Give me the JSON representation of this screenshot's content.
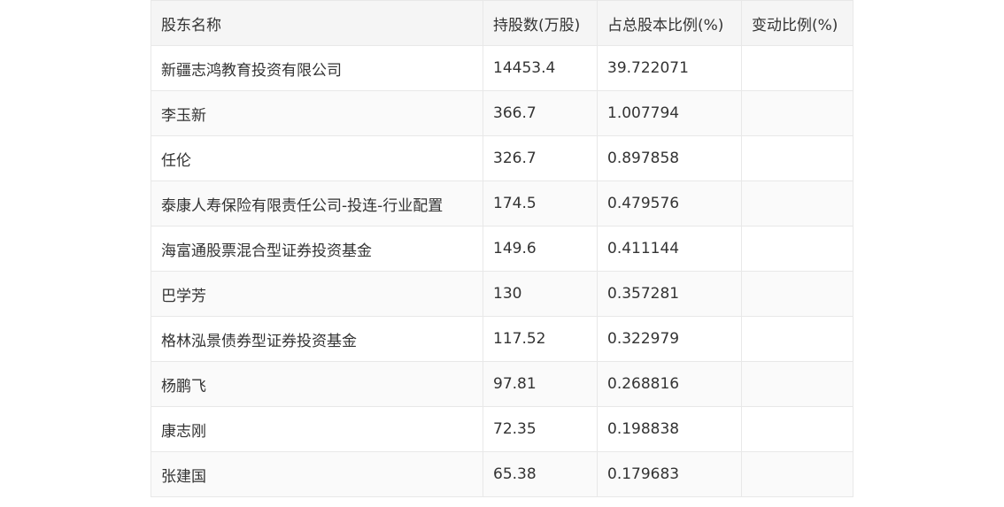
{
  "table": {
    "headers": {
      "name": "股东名称",
      "shares": "持股数(万股)",
      "ratio": "占总股本比例(%)",
      "change": "变动比例(%)"
    },
    "rows": [
      {
        "name": "新疆志鸿教育投资有限公司",
        "shares": "14453.4",
        "ratio": "39.722071",
        "change": ""
      },
      {
        "name": "李玉新",
        "shares": "366.7",
        "ratio": "1.007794",
        "change": ""
      },
      {
        "name": "任伦",
        "shares": "326.7",
        "ratio": "0.897858",
        "change": ""
      },
      {
        "name": "泰康人寿保险有限责任公司-投连-行业配置",
        "shares": "174.5",
        "ratio": "0.479576",
        "change": ""
      },
      {
        "name": "海富通股票混合型证券投资基金",
        "shares": "149.6",
        "ratio": "0.411144",
        "change": ""
      },
      {
        "name": "巴学芳",
        "shares": "130",
        "ratio": "0.357281",
        "change": ""
      },
      {
        "name": "格林泓景债券型证券投资基金",
        "shares": "117.52",
        "ratio": "0.322979",
        "change": ""
      },
      {
        "name": "杨鹏飞",
        "shares": "97.81",
        "ratio": "0.268816",
        "change": ""
      },
      {
        "name": "康志刚",
        "shares": "72.35",
        "ratio": "0.198838",
        "change": ""
      },
      {
        "name": "张建国",
        "shares": "65.38",
        "ratio": "0.179683",
        "change": ""
      }
    ]
  }
}
